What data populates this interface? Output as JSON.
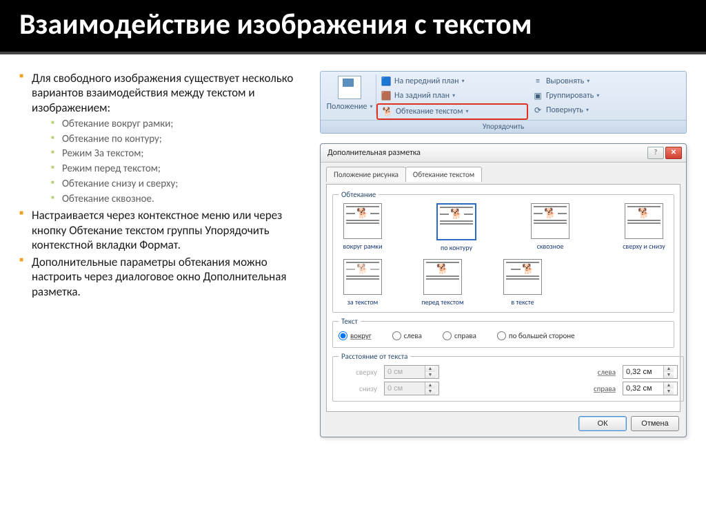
{
  "slide_title": "Взаимодействие изображения с текстом",
  "bullets": {
    "b1": "Для свободного изображения существует несколько вариантов взаимодействия между текстом и изображением:",
    "sub": {
      "s1": "Обтекание вокруг рамки;",
      "s2": "Обтекание по контуру;",
      "s3": "Режим За текстом;",
      "s4": "Режим перед текстом;",
      "s5": "Обтекание снизу и сверху;",
      "s6": "Обтекание сквозное."
    },
    "b2": "Настраивается через контекстное меню или через кнопку Обтекание текстом группы Упорядочить контекстной вкладки Формат.",
    "b3": "Дополнительные параметры обтекания можно настроить через диалоговое окно Дополнительная разметка."
  },
  "ribbon": {
    "position": "Положение",
    "bring_front": "На передний план",
    "send_back": "На задний план",
    "text_wrap": "Обтекание текстом",
    "align": "Выровнять",
    "group": "Группировать",
    "rotate": "Повернуть",
    "group_label": "Упорядочить"
  },
  "dialog": {
    "title": "Дополнительная разметка",
    "tab1": "Положение рисунка",
    "tab2": "Обтекание текстом",
    "fs_wrap": "Обтекание",
    "fs_text": "Текст",
    "fs_dist": "Расстояние от текста",
    "wrap_opts": {
      "o1": "вокруг рамки",
      "o2": "по контуру",
      "o3": "сквозное",
      "o4": "сверху и снизу",
      "o5": "за текстом",
      "o6": "перед текстом",
      "o7": "в тексте"
    },
    "text_radio": {
      "r1": "вокруг",
      "r2": "слева",
      "r3": "справа",
      "r4": "по большей стороне"
    },
    "dist": {
      "top_l": "сверху",
      "bottom_l": "снизу",
      "left_l": "слева",
      "right_l": "справа",
      "top_v": "0 см",
      "bottom_v": "0 см",
      "left_v": "0,32 см",
      "right_v": "0,32 см"
    },
    "ok": "ОК",
    "cancel": "Отмена"
  }
}
